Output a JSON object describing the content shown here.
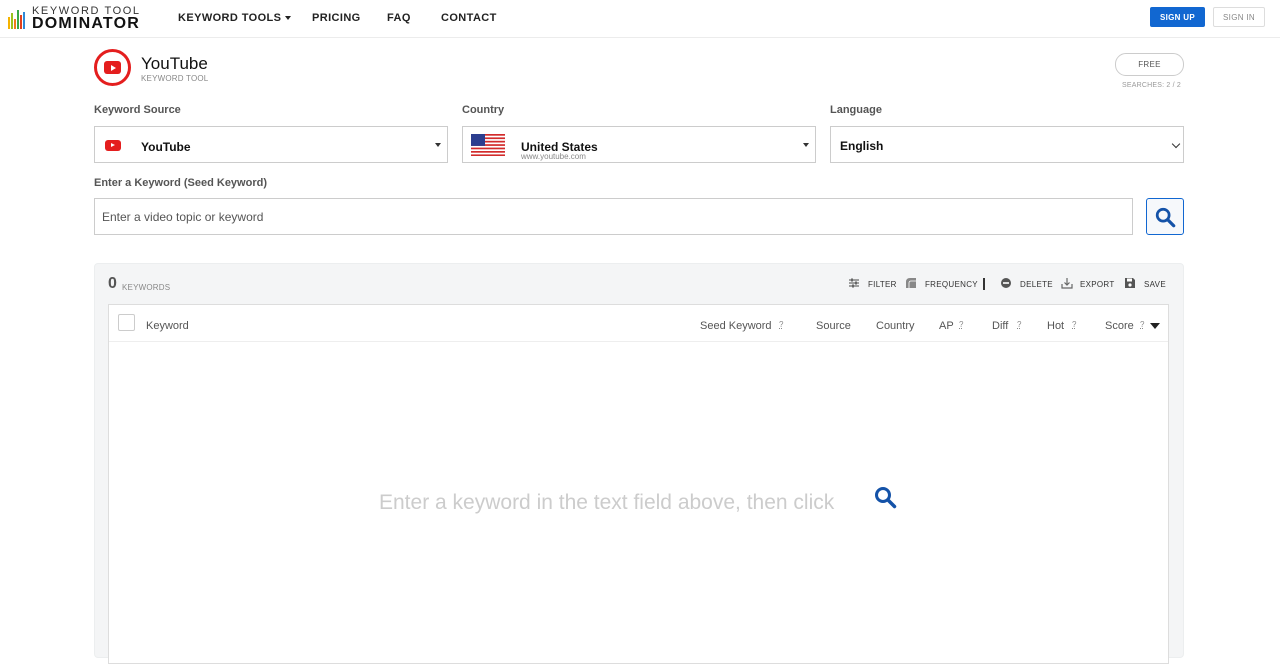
{
  "nav": {
    "logo_top": "KEYWORD TOOL",
    "logo_bottom": "DOMINATOR",
    "items": [
      "KEYWORD TOOLS",
      "PRICING",
      "FAQ",
      "CONTACT"
    ],
    "signup": "SIGN UP",
    "signin": "SIGN IN"
  },
  "header": {
    "title": "YouTube",
    "subtitle": "KEYWORD TOOL",
    "plan": "FREE",
    "searches": "SEARCHES: 2 / 2"
  },
  "form": {
    "source_label": "Keyword Source",
    "source_value": "YouTube",
    "country_label": "Country",
    "country_value": "United States",
    "country_sub": "www.youtube.com",
    "language_label": "Language",
    "language_value": "English",
    "keyword_label": "Enter a Keyword (Seed Keyword)",
    "keyword_placeholder": "Enter a video topic or keyword",
    "keyword_value": ""
  },
  "results": {
    "count": "0",
    "count_label": "KEYWORDS",
    "tools": [
      "FILTER",
      "FREQUENCY",
      "DELETE",
      "EXPORT",
      "SAVE"
    ],
    "columns": [
      "Keyword",
      "Seed Keyword",
      "Source",
      "Country",
      "AP",
      "Diff",
      "Hot",
      "Score"
    ],
    "help_mark": "?",
    "empty_message": "Enter a keyword in the text field above, then click"
  },
  "colors": {
    "accent": "#1167d1",
    "youtube_red": "#e41e1e"
  },
  "icons": [
    "youtube-icon",
    "caret-down-icon",
    "us-flag-icon",
    "search-icon",
    "filter-icon",
    "frequency-icon",
    "delete-icon",
    "export-icon",
    "save-icon",
    "sort-desc-icon"
  ]
}
